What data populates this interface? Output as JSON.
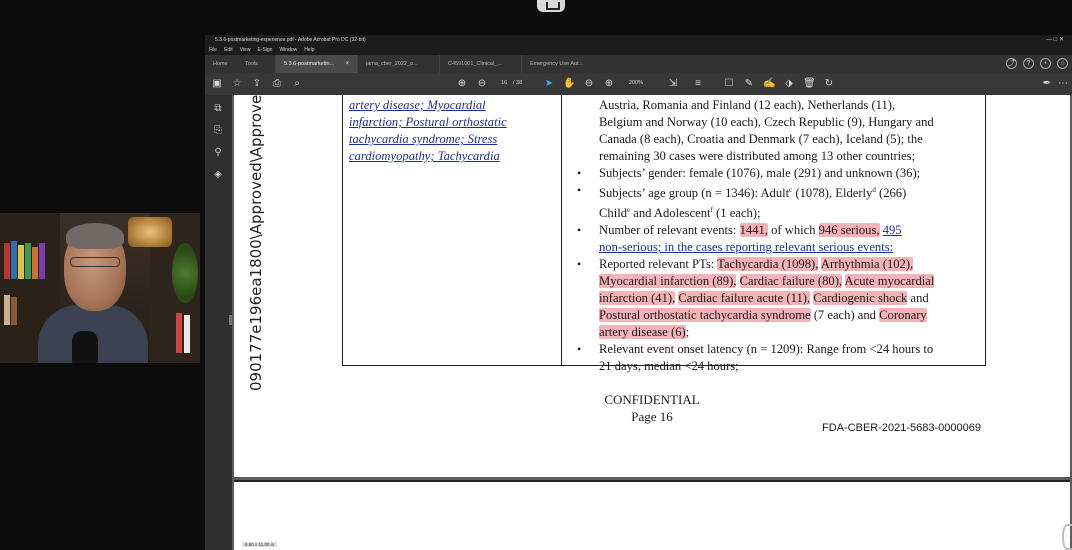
{
  "window": {
    "title": "5.3.6-postmarketing-experience.pdf - Adobe Acrobat Pro DC (32-bit)",
    "menu": [
      "File",
      "Edit",
      "View",
      "E-Sign",
      "Window",
      "Help"
    ]
  },
  "tabs": [
    {
      "label": "Home"
    },
    {
      "label": "Tools"
    },
    {
      "label": "5.3.6-postmarketin...",
      "close": "×"
    },
    {
      "label": "jama_cber_2022_o..."
    },
    {
      "label": "C4591001_Clinical_..."
    },
    {
      "label": "Emergency Use Aut..."
    }
  ],
  "toolbar": {
    "page_current": "16",
    "page_total": "/ 38",
    "zoom": "200%"
  },
  "page": {
    "stamp": "090177e196ea1800\\Approved\\Approve",
    "col1_lines": [
      "artery disease; Myocardial",
      "infarction; Postural orthostatic",
      "tachycardia syndrome; Stress",
      "cardiomyopathy; Tachycardia"
    ],
    "col2": {
      "cont1": "Austria, Romania and Finland (12 each), Netherlands (11),",
      "cont2": "Belgium and Norway (10 each), Czech Republic (9), Hungary and",
      "cont3": "Canada (8 each), Croatia and Denmark (7 each), Iceland (5); the",
      "cont4": "remaining 30 cases were distributed among 13 other countries;",
      "gender": "Subjects’ gender: female (1076), male (291) and unknown (36);",
      "age1": "Subjects’ age group (n = 1346): Adult",
      "age_sup_c": "c",
      "age2": " (1078), Elderly",
      "age_sup_d": "d",
      "age3": " (266)",
      "age4": "Child",
      "age_sup_e": "e",
      "age5": " and Adolescent",
      "age_sup_f": "f",
      "age6": " (1 each);",
      "events1": "Number of relevant events: ",
      "events_total": "1441,",
      "events2": " of which ",
      "events_serious": "946 serious,",
      "events_nonserious_num": "495",
      "events3": "non-serious; in the cases reporting relevant serious events:",
      "pts_intro": "Reported relevant PTs: ",
      "pt1": "Tachycardia (1098),",
      "pt2": "Arrhythmia (102),",
      "pt3": "Myocardial infarction (89),",
      "pt4": "Cardiac failure (80),",
      "pt5": "Acute myocardial",
      "pt6": "infarction (41),",
      "pt7": "Cardiac failure acute (11),",
      "pt8": "Cardiogenic shock",
      "pt_and": " and",
      "pt9": "Postural orthostatic tachycardia syndrome",
      "pt10": " (7 each) and ",
      "pt11": "Coronary",
      "pt12": "artery disease (6)",
      "pt_end": ";",
      "latency1": "Relevant event onset latency (n = 1209): Range from <24 hours to",
      "latency2": "21 days, median <24 hours;"
    },
    "confidential": "CONFIDENTIAL",
    "page_label": "Page 16",
    "fda_id": "FDA-CBER-2021-5683-0000069",
    "size_label": "8.50 x 11.00 in"
  }
}
